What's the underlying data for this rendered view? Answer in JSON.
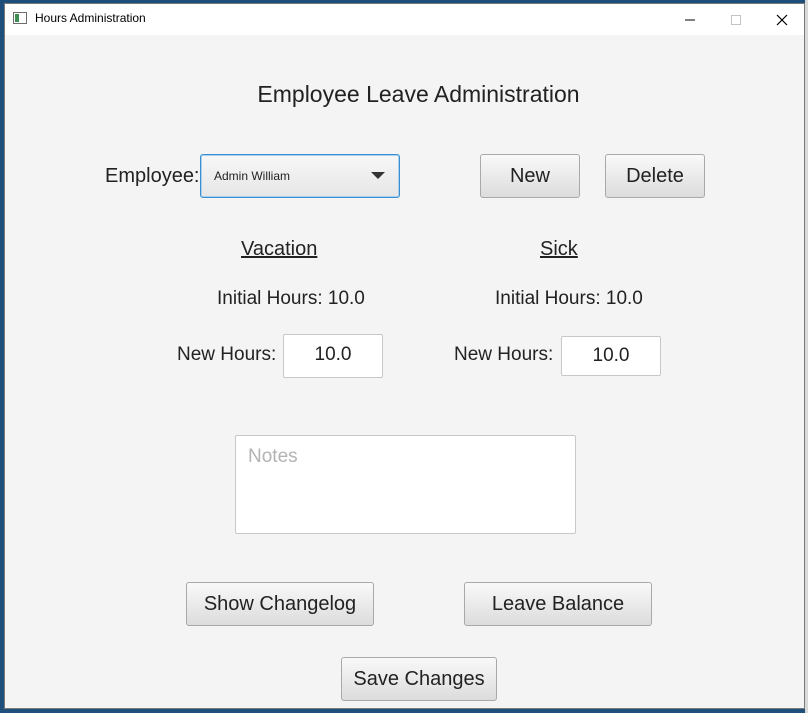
{
  "window": {
    "title": "Hours Administration"
  },
  "heading": "Employee Leave Administration",
  "employee": {
    "label": "Employee:",
    "selected": "Admin William",
    "new_button": "New",
    "delete_button": "Delete"
  },
  "vacation": {
    "header": "Vacation",
    "initial_hours": "Initial Hours: 10.0",
    "new_hours_label": "New Hours:",
    "new_hours_value": "10.0"
  },
  "sick": {
    "header": "Sick",
    "initial_hours": "Initial Hours: 10.0",
    "new_hours_label": "New Hours:",
    "new_hours_value": "10.0"
  },
  "notes": {
    "placeholder": "Notes"
  },
  "buttons": {
    "show_changelog": "Show Changelog",
    "leave_balance": "Leave Balance",
    "save_changes": "Save Changes"
  },
  "icons": {
    "app": "app-window-icon",
    "minimize": "minimize-icon",
    "maximize": "maximize-icon",
    "close": "close-icon",
    "dropdown": "chevron-down-icon"
  },
  "colors": {
    "focus": "#3c8fcf",
    "background": "#f4f4f4"
  }
}
